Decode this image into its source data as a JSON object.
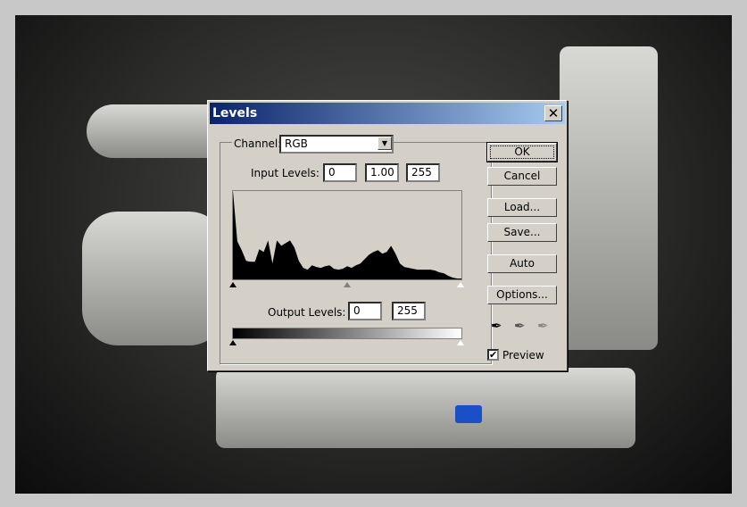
{
  "dialog": {
    "title": "Levels",
    "close_label": "✕"
  },
  "channel": {
    "label": "Channel:",
    "value": "RGB"
  },
  "input_levels": {
    "label": "Input Levels:",
    "black": "0",
    "gamma": "1.00",
    "white": "255"
  },
  "output_levels": {
    "label": "Output Levels:",
    "black": "0",
    "white": "255"
  },
  "buttons": {
    "ok": "OK",
    "cancel": "Cancel",
    "load": "Load...",
    "save": "Save...",
    "auto": "Auto",
    "options": "Options..."
  },
  "preview": {
    "label": "Preview",
    "checked": true
  },
  "histogram": [
    1.0,
    0.43,
    0.33,
    0.21,
    0.2,
    0.2,
    0.34,
    0.31,
    0.44,
    0.18,
    0.44,
    0.38,
    0.41,
    0.44,
    0.36,
    0.21,
    0.13,
    0.11,
    0.16,
    0.14,
    0.13,
    0.15,
    0.16,
    0.12,
    0.11,
    0.12,
    0.15,
    0.13,
    0.16,
    0.18,
    0.23,
    0.28,
    0.31,
    0.33,
    0.29,
    0.31,
    0.38,
    0.29,
    0.18,
    0.14,
    0.13,
    0.12,
    0.11,
    0.11,
    0.11,
    0.11,
    0.1,
    0.08,
    0.07,
    0.04,
    0.02,
    0.01,
    0.01
  ]
}
